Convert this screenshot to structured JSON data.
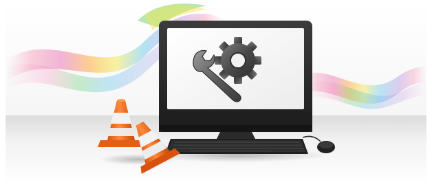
{
  "scene": {
    "description_kind": "maintenance illustration",
    "colors": {
      "background": "#ffffff",
      "floor": "#eeeeee",
      "monitor_body": "#2a2a2a",
      "screen": "#f4f4f4",
      "gear": "#4e4e4e",
      "wrench": "#6a6a6a",
      "cone_orange": "#f26a1b",
      "cone_white": "#f3f3f3",
      "keyboard": "#262626"
    },
    "icons": [
      "monitor-icon",
      "gear-icon",
      "wrench-icon",
      "traffic-cone-icon",
      "keyboard-icon",
      "mouse-icon"
    ]
  }
}
